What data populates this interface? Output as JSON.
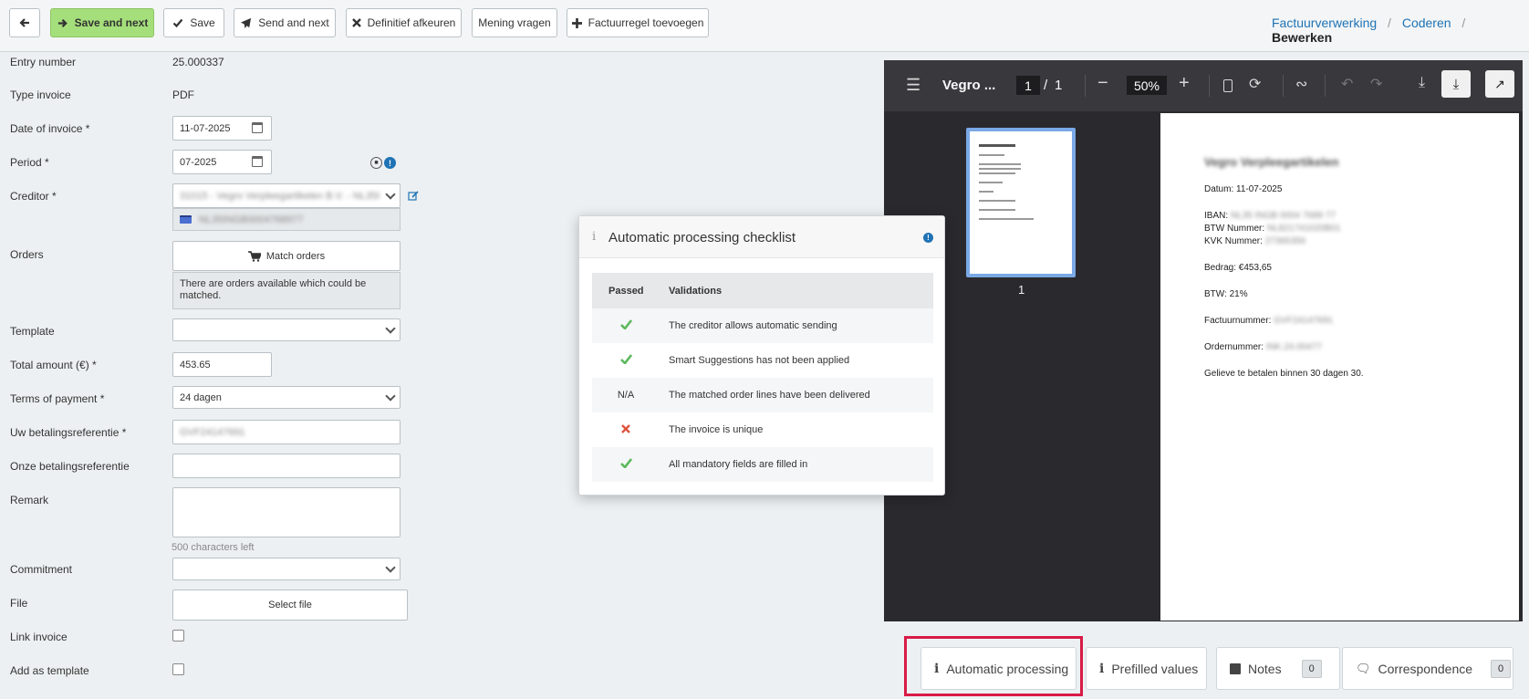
{
  "toolbar": {
    "save_and_next": "Save and next",
    "save": "Save",
    "send_and_next": "Send and next",
    "reject": "Definitief afkeuren",
    "ask_opinion": "Mening vragen",
    "add_line": "Factuurregel toevoegen"
  },
  "breadcrumb": {
    "item1": "Factuurverwerking",
    "item2": "Coderen",
    "current": "Bewerken",
    "separator": "/"
  },
  "form": {
    "entry_number_label": "Entry number",
    "entry_number": "25.000337",
    "type_invoice_label": "Type invoice",
    "type_invoice": "PDF",
    "date_label": "Date of invoice *",
    "date_value": "11-07-2025",
    "period_label": "Period *",
    "period_value": "07-2025",
    "creditor_label": "Creditor *",
    "creditor_value": "31015 - Vegro Verpleegartikelen B.V. - NL35INGB",
    "creditor_iban": "NL35INGB0004768977",
    "orders_label": "Orders",
    "match_orders": "Match orders",
    "orders_notice": "There are orders available which could be matched.",
    "template_label": "Template",
    "total_label": "Total amount (€) *",
    "total_value": "453.65",
    "terms_label": "Terms of payment *",
    "terms_value": "24 dagen",
    "uw_ref_label": "Uw betalingsreferentie *",
    "uw_ref_value": "GVF24147691",
    "onze_ref_label": "Onze betalingsreferentie",
    "remark_label": "Remark",
    "chars_left": "500 characters left",
    "commitment_label": "Commitment",
    "file_label": "File",
    "select_file": "Select file",
    "link_label": "Link invoice",
    "template_add_label": "Add as template"
  },
  "popup": {
    "title": "Automatic processing checklist",
    "col_passed": "Passed",
    "col_validations": "Validations",
    "rows": [
      {
        "status": "check",
        "text": "The creditor allows automatic sending"
      },
      {
        "status": "check",
        "text": "Smart Suggestions has not been applied"
      },
      {
        "status": "N/A",
        "text": "The matched order lines have been delivered"
      },
      {
        "status": "cross",
        "text": "The invoice is unique"
      },
      {
        "status": "check",
        "text": "All mandatory fields are filled in"
      }
    ],
    "colors": {
      "check": "#5cb85c",
      "cross": "#e0533d"
    }
  },
  "viewer": {
    "doc_title": "Vegro ...",
    "page_current": "1",
    "page_sep": "/",
    "page_total": "1",
    "zoom": "50%",
    "thumb_label": "1",
    "page": {
      "heading": "Vegro Verpleegartikelen",
      "datum": "Datum: 11-07-2025",
      "iban_label": "IBAN:",
      "iban": "NL35 INGB 0004 7689 77",
      "btw_nr_label": "BTW Nummer:",
      "btw_nr": "NL821741020B01",
      "kvk_label": "KVK Nummer:",
      "kvk": "27365356",
      "bedrag": "Bedrag: €453,65",
      "btw": "BTW: 21%",
      "factuurnr_label": "Factuurnummer:",
      "factuurnr": "GVF24147691",
      "ordernr_label": "Ordernummer:",
      "ordernr": "INK.24.00477",
      "footer": "Gelieve te betalen binnen 30 dagen 30."
    }
  },
  "tabs": {
    "auto": "Automatic processing",
    "prefilled": "Prefilled values",
    "notes": "Notes",
    "notes_count": "0",
    "corr": "Correspondence",
    "corr_count": "0"
  },
  "accent": "#d81b46"
}
